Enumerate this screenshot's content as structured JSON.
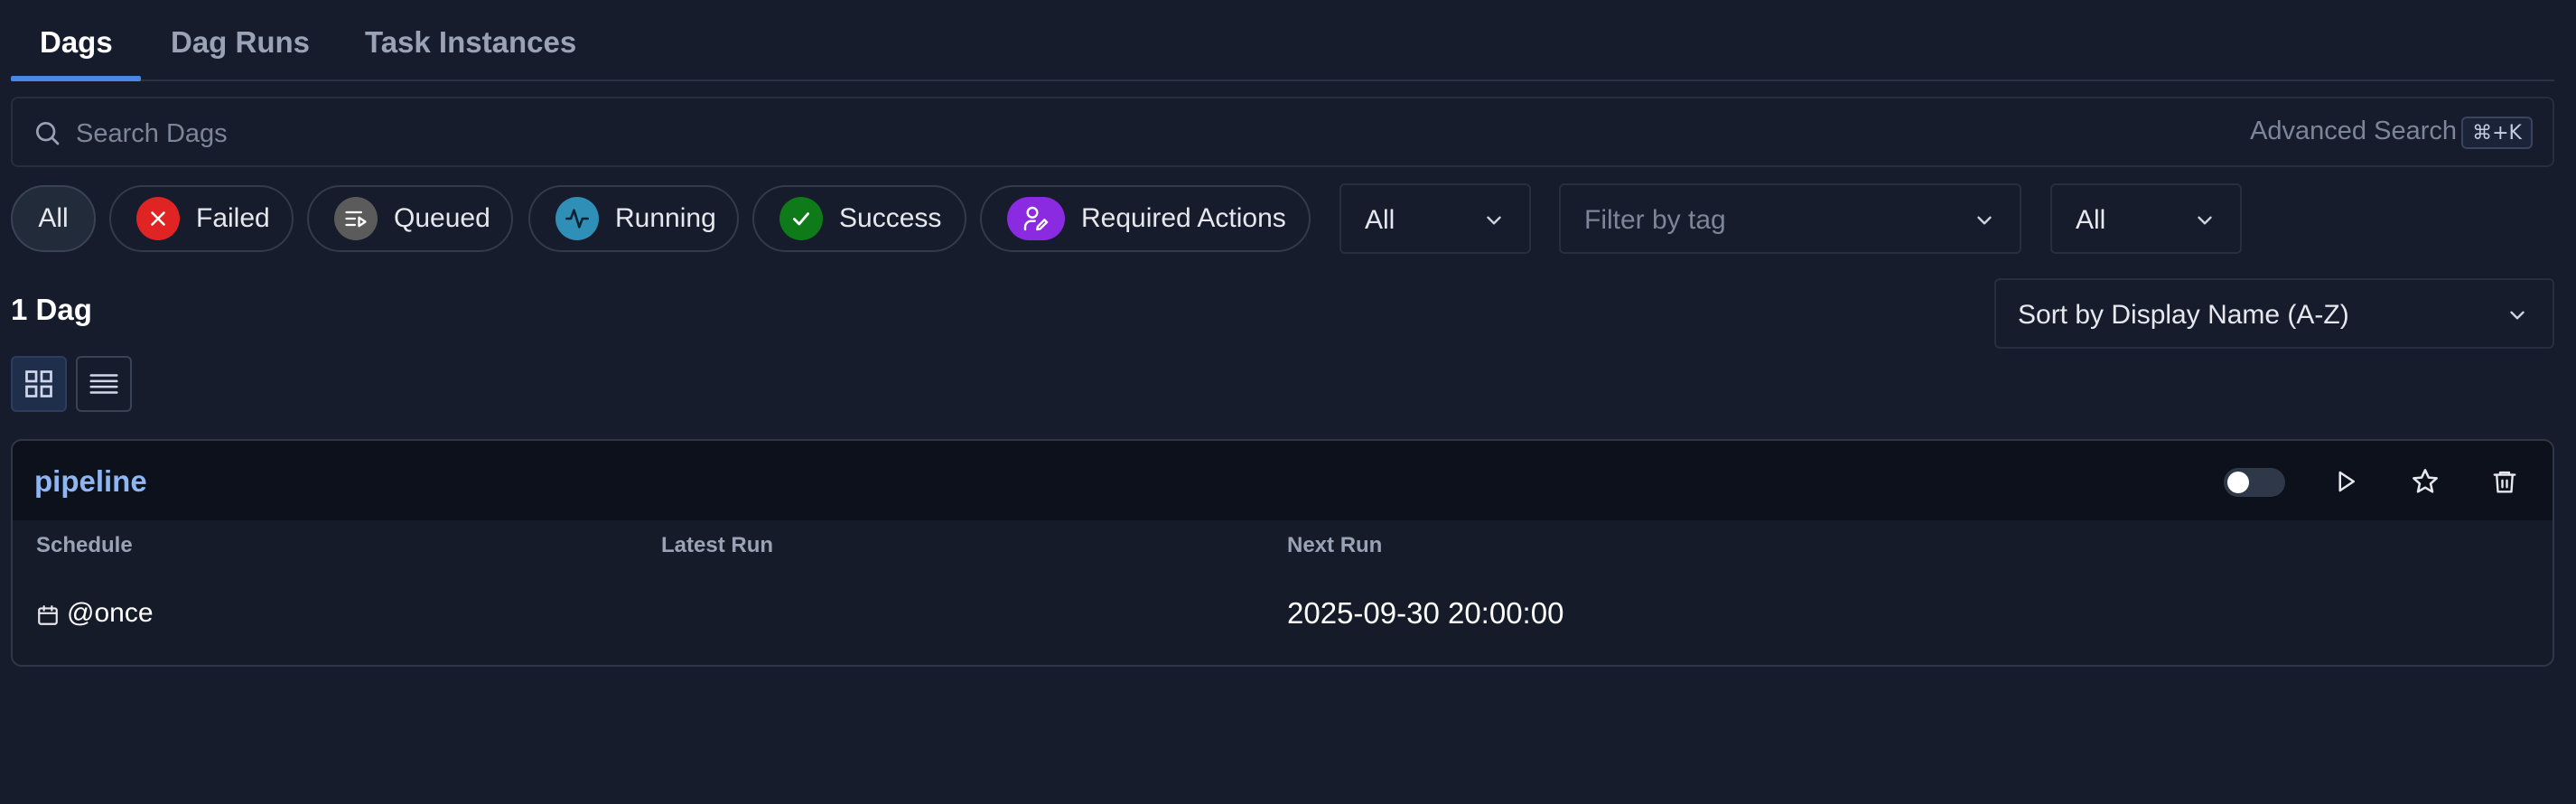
{
  "tabs": [
    {
      "label": "Dags",
      "active": true
    },
    {
      "label": "Dag Runs",
      "active": false
    },
    {
      "label": "Task Instances",
      "active": false
    }
  ],
  "search": {
    "placeholder": "Search Dags",
    "advanced_label": "Advanced Search",
    "shortcut": "⌘+K"
  },
  "state_filters": [
    {
      "label": "All",
      "icon": null,
      "selected": true
    },
    {
      "label": "Failed",
      "icon": "x-icon",
      "color": "#e02424"
    },
    {
      "label": "Queued",
      "icon": "queue-icon",
      "color": "#5b5b5b"
    },
    {
      "label": "Running",
      "icon": "activity-icon",
      "color": "#2f8fb7"
    },
    {
      "label": "Success",
      "icon": "check-icon",
      "color": "#0e7a1a"
    },
    {
      "label": "Required Actions",
      "icon": "user-edit-icon",
      "color": "#8a2be2"
    }
  ],
  "filters": {
    "paused_select": "All",
    "tag_placeholder": "Filter by tag",
    "tag_mode_select": "All"
  },
  "results": {
    "count_label": "1 Dag",
    "sort_label": "Sort by Display Name (A-Z)",
    "view_mode": "card"
  },
  "dag": {
    "name": "pipeline",
    "paused": true,
    "columns": {
      "schedule_header": "Schedule",
      "latest_run_header": "Latest Run",
      "next_run_header": "Next Run"
    },
    "schedule": "@once",
    "latest_run": "",
    "next_run": "2025-09-30 20:00:00"
  },
  "colors": {
    "background": "#161c2c",
    "accent": "#4a86e8",
    "dag_link": "#8fb6f3"
  }
}
